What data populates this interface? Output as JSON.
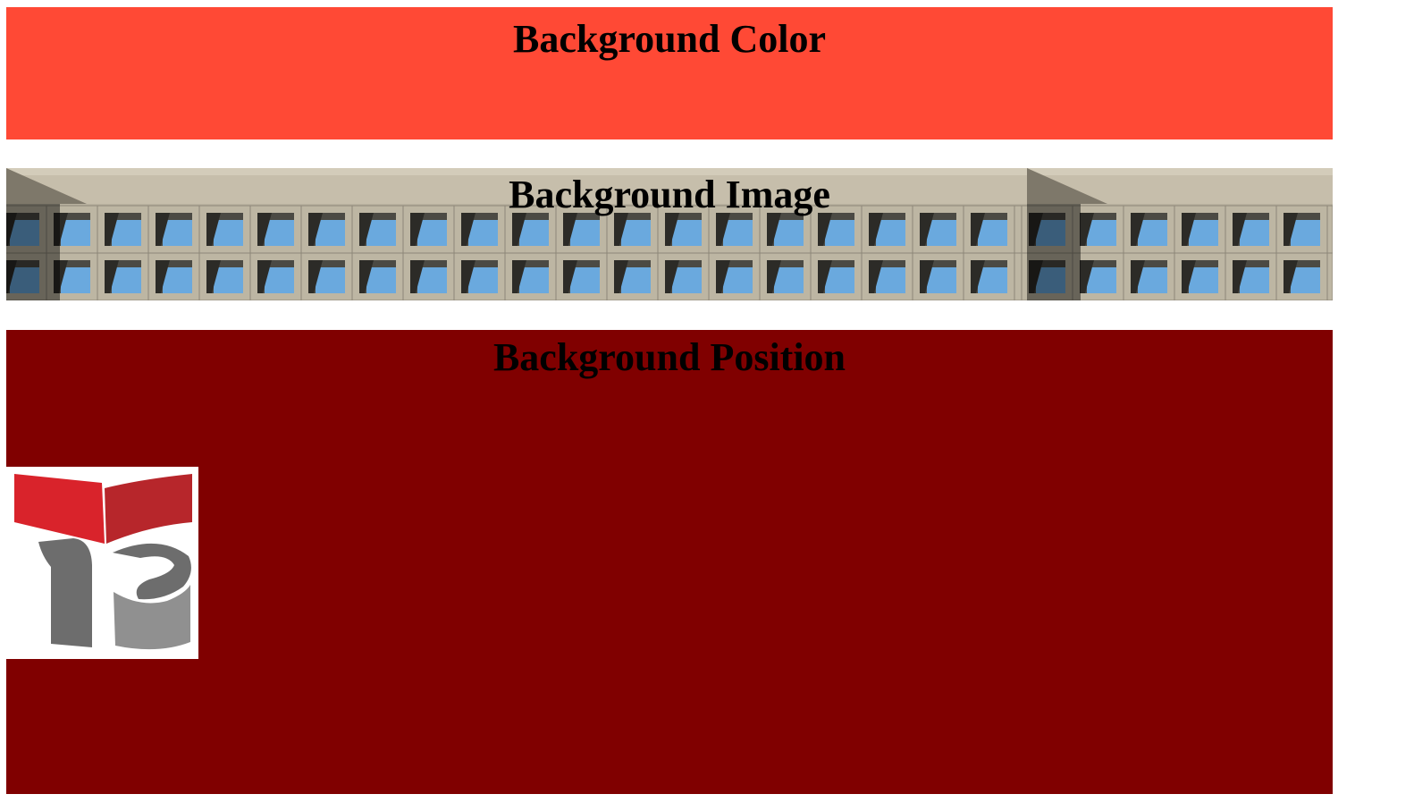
{
  "sections": {
    "color": {
      "heading": "Background Color",
      "background": "#ff4935"
    },
    "image": {
      "heading": "Background Image",
      "image_name": "concrete-breeze-block-wall"
    },
    "position": {
      "heading": "Background Position",
      "background": "#800000",
      "image_name": "red-book-logo"
    }
  },
  "colors": {
    "page_background": "#ffffff",
    "heading_text": "#000000",
    "concrete": "#c6beab",
    "sky": "#6aa9de",
    "logo_red": "#d9232b",
    "logo_gray": "#6d6d6d"
  }
}
